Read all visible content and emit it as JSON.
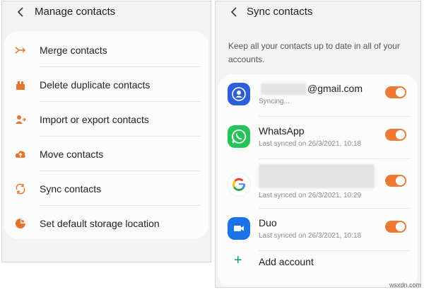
{
  "left_panel": {
    "title": "Manage contacts",
    "items": [
      {
        "label": "Merge contacts",
        "icon": "merge-icon"
      },
      {
        "label": "Delete duplicate contacts",
        "icon": "delete-duplicate-icon"
      },
      {
        "label": "Import or export contacts",
        "icon": "import-export-icon"
      },
      {
        "label": "Move contacts",
        "icon": "cloud-upload-icon"
      },
      {
        "label": "Sync contacts",
        "icon": "sync-icon"
      },
      {
        "label": "Set default storage location",
        "icon": "storage-pie-icon"
      }
    ],
    "accent_color": "#e8732c"
  },
  "right_panel": {
    "title": "Sync contacts",
    "description": "Keep all your contacts up to date in all of your accounts.",
    "accounts": [
      {
        "name": "@gmail.com",
        "status": "Syncing...",
        "icon": "samsung-contacts-icon",
        "enabled": true
      },
      {
        "name": "WhatsApp",
        "status": "Last synced on 26/3/2021, 10:18",
        "icon": "whatsapp-icon",
        "enabled": true
      },
      {
        "name": "",
        "status": "Last synced on 26/3/2021, 10:29",
        "icon": "google-icon",
        "enabled": true
      },
      {
        "name": "Duo",
        "status": "Last synced on 26/3/2021, 10:18",
        "icon": "duo-icon",
        "enabled": true
      }
    ],
    "add_account_label": "Add account",
    "toggle_color": "#ec7a33"
  },
  "watermark": "wsxdn.com"
}
